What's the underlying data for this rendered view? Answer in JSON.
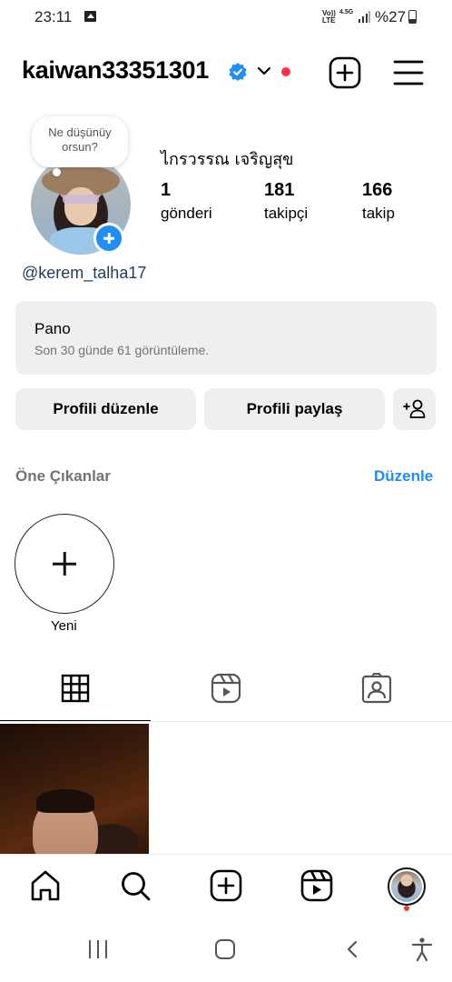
{
  "status_bar": {
    "time": "23:11",
    "network_volte": "Vo))\nLTE",
    "network_type": "4.5G",
    "battery_percent": "%27"
  },
  "header": {
    "username": "kaiwan33351301",
    "verified": true,
    "icons": [
      "verified-badge-icon",
      "chevron-down-icon",
      "add-square-icon",
      "hamburger-menu-icon"
    ],
    "notification_dot_color": "#ff3040"
  },
  "profile": {
    "note_text": "Ne düşünüy\norsun?",
    "full_name": "ไกรวรรณ เจริญสุข",
    "handle": "@kerem_talha17",
    "stats": {
      "posts_count": "1",
      "posts_label": "gönderi",
      "followers_count": "181",
      "followers_label": "takipçi",
      "following_count": "166",
      "following_label": "takip"
    }
  },
  "dashboard": {
    "title": "Pano",
    "subtitle": "Son 30 günde 61 görüntüleme."
  },
  "actions": {
    "edit_profile": "Profili düzenle",
    "share_profile": "Profili paylaş",
    "add_user_icon": "add-person-icon"
  },
  "highlights": {
    "title": "Öne Çıkanlar",
    "edit_label": "Düzenle",
    "new_label": "Yeni"
  },
  "tabs": [
    {
      "name": "grid",
      "icon": "grid-icon",
      "active": true
    },
    {
      "name": "reels",
      "icon": "reels-icon",
      "active": false
    },
    {
      "name": "tagged",
      "icon": "tagged-person-icon",
      "active": false
    }
  ],
  "bottom_nav": [
    "home-icon",
    "search-icon",
    "create-icon",
    "reels-icon",
    "profile-avatar"
  ],
  "colors": {
    "accent_blue": "#1d8ff2",
    "verified_blue": "#1f8ff7",
    "card_bg": "#efefef",
    "muted_text": "#737373"
  }
}
